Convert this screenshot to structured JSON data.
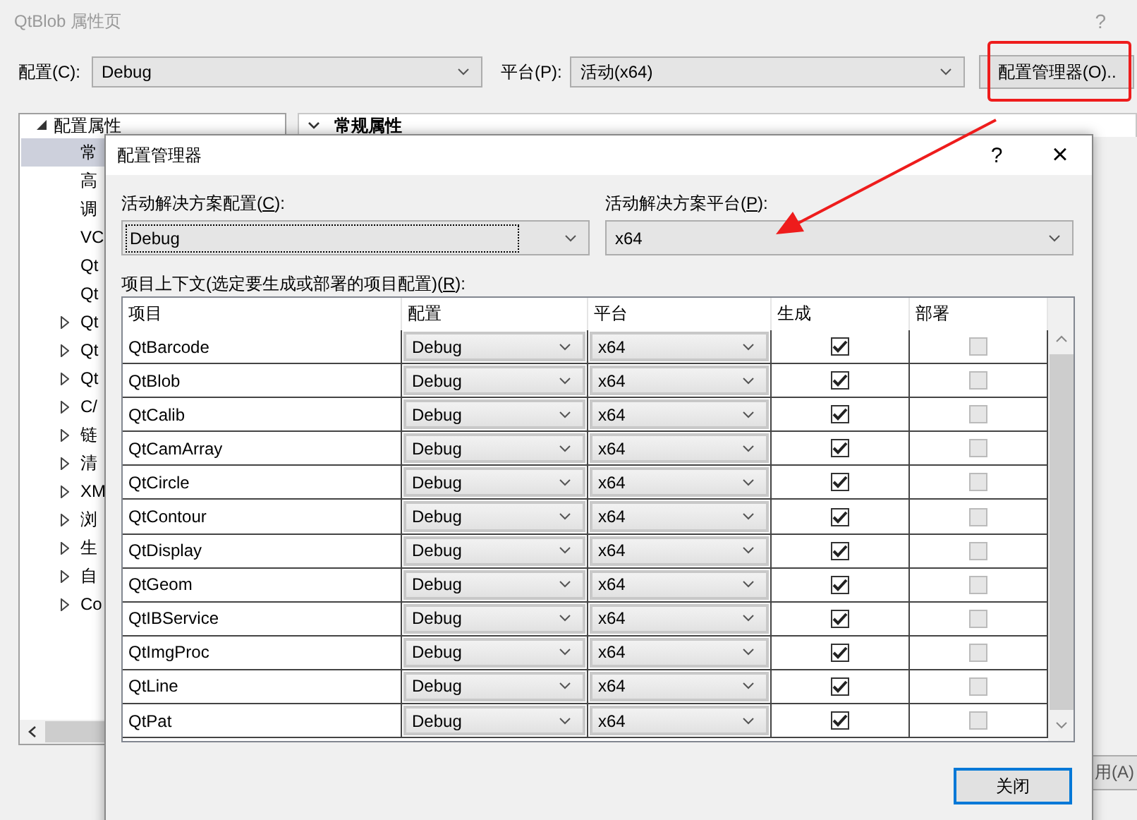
{
  "window": {
    "title": "QtBlob 属性页",
    "help": "?"
  },
  "toolbar": {
    "config_label": "配置(C):",
    "config_value": "Debug",
    "platform_label": "平台(P):",
    "platform_value": "活动(x64)",
    "manager_button": "配置管理器(O).."
  },
  "tree": [
    {
      "label": "配置属性",
      "expanded": true,
      "children": [
        {
          "label": "常",
          "selected": true,
          "expandable": false
        },
        {
          "label": "高",
          "selected": false,
          "expandable": false
        },
        {
          "label": "调",
          "selected": false,
          "expandable": false
        },
        {
          "label": "VC",
          "selected": false,
          "expandable": false
        },
        {
          "label": "Qt",
          "selected": false,
          "expandable": false
        },
        {
          "label": "Qt",
          "selected": false,
          "expandable": false
        },
        {
          "label": "Qt",
          "selected": false,
          "expandable": true
        },
        {
          "label": "Qt",
          "selected": false,
          "expandable": true
        },
        {
          "label": "Qt",
          "selected": false,
          "expandable": true
        },
        {
          "label": "C/",
          "selected": false,
          "expandable": true
        },
        {
          "label": "链",
          "selected": false,
          "expandable": true
        },
        {
          "label": "清",
          "selected": false,
          "expandable": true
        },
        {
          "label": "XM",
          "selected": false,
          "expandable": true
        },
        {
          "label": "浏",
          "selected": false,
          "expandable": true
        },
        {
          "label": "生",
          "selected": false,
          "expandable": true
        },
        {
          "label": "自",
          "selected": false,
          "expandable": true
        },
        {
          "label": "Co",
          "selected": false,
          "expandable": true
        }
      ]
    }
  ],
  "section_header": "常规属性",
  "apply_button": "用(A)",
  "dialog": {
    "title": "配置管理器",
    "help": "?",
    "close": "×",
    "config_label": {
      "before": "活动解决方案配置(",
      "key": "C",
      "after": "):"
    },
    "config_value": "Debug",
    "platform_label": {
      "before": "活动解决方案平台(",
      "key": "P",
      "after": "):"
    },
    "platform_value": "x64",
    "grid_label": {
      "before": "项目上下文(选定要生成或部署的项目配置)(",
      "key": "R",
      "after": "):"
    },
    "columns": [
      "项目",
      "配置",
      "平台",
      "生成",
      "部署"
    ],
    "rows": [
      {
        "project": "QtBarcode",
        "config": "Debug",
        "platform": "x64",
        "build": true,
        "deploy": false,
        "deploy_disabled": true
      },
      {
        "project": "QtBlob",
        "config": "Debug",
        "platform": "x64",
        "build": true,
        "deploy": false,
        "deploy_disabled": true
      },
      {
        "project": "QtCalib",
        "config": "Debug",
        "platform": "x64",
        "build": true,
        "deploy": false,
        "deploy_disabled": true
      },
      {
        "project": "QtCamArray",
        "config": "Debug",
        "platform": "x64",
        "build": true,
        "deploy": false,
        "deploy_disabled": true
      },
      {
        "project": "QtCircle",
        "config": "Debug",
        "platform": "x64",
        "build": true,
        "deploy": false,
        "deploy_disabled": true
      },
      {
        "project": "QtContour",
        "config": "Debug",
        "platform": "x64",
        "build": true,
        "deploy": false,
        "deploy_disabled": true
      },
      {
        "project": "QtDisplay",
        "config": "Debug",
        "platform": "x64",
        "build": true,
        "deploy": false,
        "deploy_disabled": true
      },
      {
        "project": "QtGeom",
        "config": "Debug",
        "platform": "x64",
        "build": true,
        "deploy": false,
        "deploy_disabled": true
      },
      {
        "project": "QtIBService",
        "config": "Debug",
        "platform": "x64",
        "build": true,
        "deploy": false,
        "deploy_disabled": true
      },
      {
        "project": "QtImgProc",
        "config": "Debug",
        "platform": "x64",
        "build": true,
        "deploy": false,
        "deploy_disabled": true
      },
      {
        "project": "QtLine",
        "config": "Debug",
        "platform": "x64",
        "build": true,
        "deploy": false,
        "deploy_disabled": true
      },
      {
        "project": "QtPat",
        "config": "Debug",
        "platform": "x64",
        "build": true,
        "deploy": false,
        "deploy_disabled": true
      }
    ],
    "close_button": "关闭"
  },
  "annotations": {
    "highlight_box": true,
    "arrow": true
  }
}
